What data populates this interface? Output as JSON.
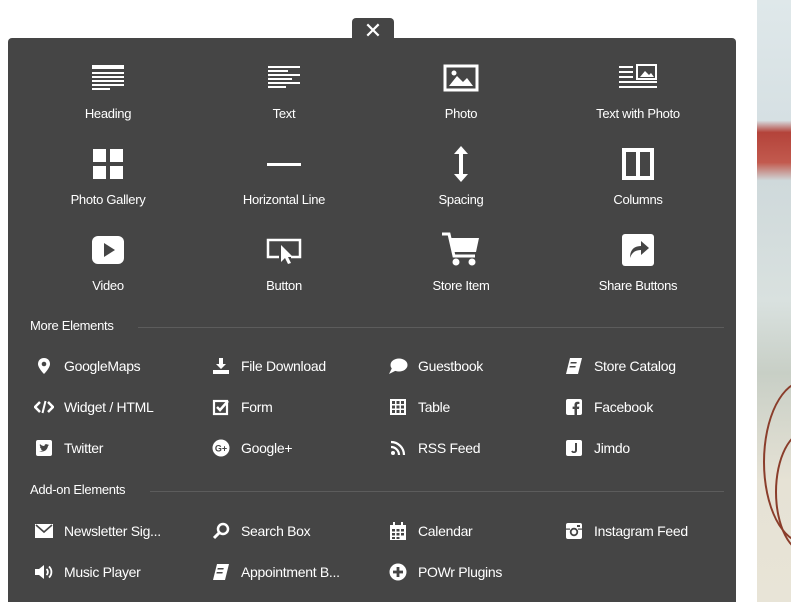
{
  "close_label": "✕",
  "tiles": [
    {
      "label": "Heading",
      "icon": "heading-icon"
    },
    {
      "label": "Text",
      "icon": "text-icon"
    },
    {
      "label": "Photo",
      "icon": "photo-icon"
    },
    {
      "label": "Text with Photo",
      "icon": "text-with-photo-icon"
    },
    {
      "label": "Photo Gallery",
      "icon": "photo-gallery-icon"
    },
    {
      "label": "Horizontal Line",
      "icon": "horizontal-line-icon"
    },
    {
      "label": "Spacing",
      "icon": "spacing-icon"
    },
    {
      "label": "Columns",
      "icon": "columns-icon"
    },
    {
      "label": "Video",
      "icon": "video-icon"
    },
    {
      "label": "Button",
      "icon": "button-icon"
    },
    {
      "label": "Store Item",
      "icon": "cart-icon"
    },
    {
      "label": "Share Buttons",
      "icon": "share-icon"
    }
  ],
  "more_elements": {
    "title": "More Elements",
    "items": [
      {
        "label": "GoogleMaps",
        "icon": "map-pin-icon"
      },
      {
        "label": "File Download",
        "icon": "download-icon"
      },
      {
        "label": "Guestbook",
        "icon": "speech-bubble-icon"
      },
      {
        "label": "Store Catalog",
        "icon": "catalog-book-icon"
      },
      {
        "label": "Widget / HTML",
        "icon": "code-icon"
      },
      {
        "label": "Form",
        "icon": "form-checkbox-icon"
      },
      {
        "label": "Table",
        "icon": "table-icon"
      },
      {
        "label": "Facebook",
        "icon": "facebook-icon"
      },
      {
        "label": "Twitter",
        "icon": "twitter-icon"
      },
      {
        "label": "Google+",
        "icon": "google-plus-icon"
      },
      {
        "label": "RSS Feed",
        "icon": "rss-icon"
      },
      {
        "label": "Jimdo",
        "icon": "jimdo-icon"
      }
    ]
  },
  "addon_elements": {
    "title": "Add-on Elements",
    "items": [
      {
        "label": "Newsletter Sig...",
        "icon": "envelope-icon"
      },
      {
        "label": "Search Box",
        "icon": "search-icon"
      },
      {
        "label": "Calendar",
        "icon": "calendar-icon"
      },
      {
        "label": "Instagram Feed",
        "icon": "instagram-icon"
      },
      {
        "label": "Music Player",
        "icon": "speaker-icon"
      },
      {
        "label": "Appointment B...",
        "icon": "appointment-book-icon"
      },
      {
        "label": "POWr Plugins",
        "icon": "plus-circle-icon"
      }
    ]
  },
  "colors": {
    "panel": "#454545",
    "text": "#ffffff"
  }
}
